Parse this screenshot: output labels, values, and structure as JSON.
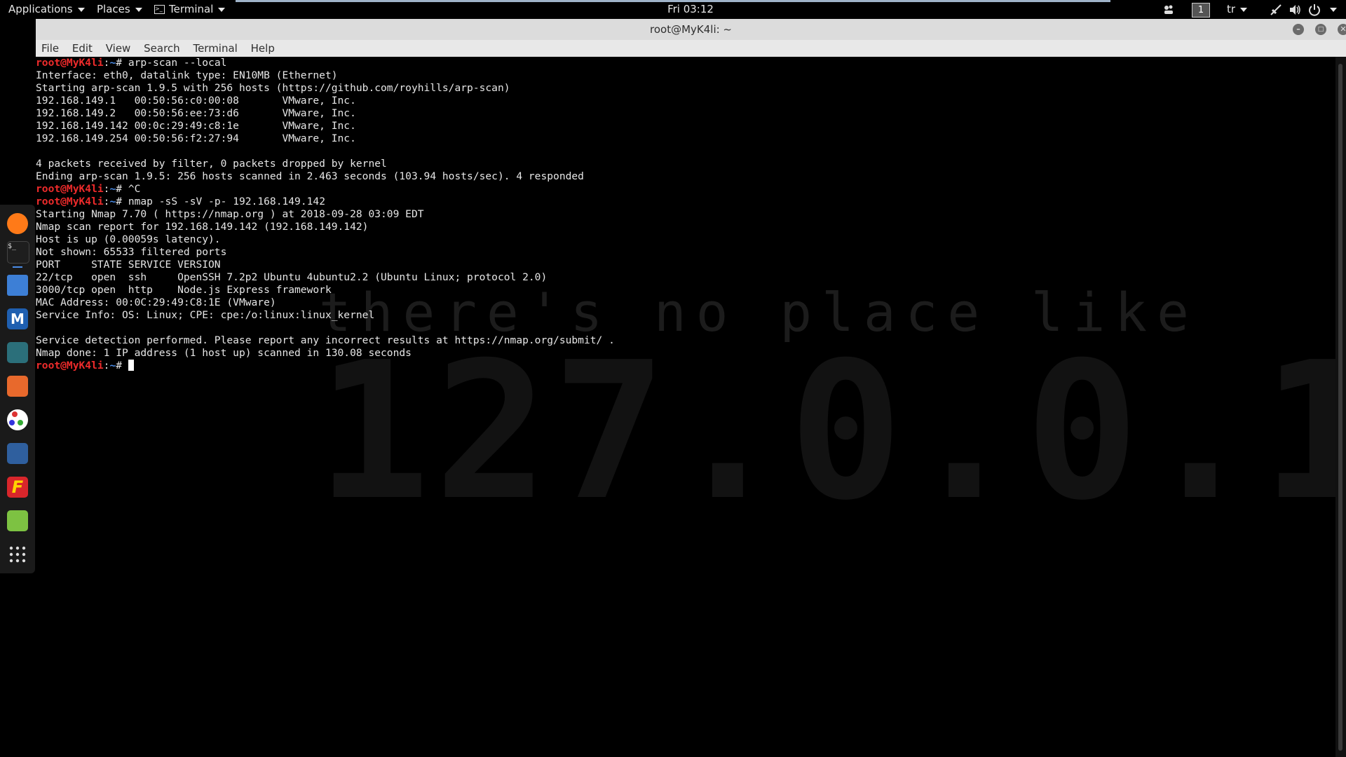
{
  "topbar": {
    "applications": "Applications",
    "places": "Places",
    "terminal": "Terminal",
    "clock": "Fri 03:12",
    "workspace": "1",
    "keyboard_layout": "tr",
    "icons": [
      "workspaces-icon",
      "network-icon",
      "volume-icon",
      "power-icon"
    ]
  },
  "dock": {
    "apps": [
      {
        "name": "firefox-icon",
        "color": "#ff7a18"
      },
      {
        "name": "terminal-icon",
        "color": "#1e1e1e"
      },
      {
        "name": "files-icon",
        "color": "#3d7fd6"
      },
      {
        "name": "metasploit-icon",
        "color": "#1f5fb0"
      },
      {
        "name": "armitage-icon",
        "color": "#2b6f7a"
      },
      {
        "name": "burpsuite-icon",
        "color": "#e8692c"
      },
      {
        "name": "maltego-icon",
        "color": "#2a2a2a"
      },
      {
        "name": "beef-icon",
        "color": "#2f5f9e"
      },
      {
        "name": "faraday-icon",
        "color": "#d8262b"
      },
      {
        "name": "leafpad-icon",
        "color": "#7dc242"
      },
      {
        "name": "show-apps-icon",
        "color": "#1a1a1a"
      }
    ]
  },
  "window": {
    "title": "root@MyK4li: ~",
    "menu": [
      "File",
      "Edit",
      "View",
      "Search",
      "Terminal",
      "Help"
    ]
  },
  "wallpaper": {
    "line1": "there's no place like",
    "line2": "127.0.0.1"
  },
  "prompt": {
    "user": "root@MyK4li",
    "sep": ":",
    "dir": "~",
    "symbol": "# "
  },
  "terminal": {
    "lines": [
      {
        "prompt": true,
        "text": "arp-scan --local"
      },
      {
        "text": "Interface: eth0, datalink type: EN10MB (Ethernet)"
      },
      {
        "text": "Starting arp-scan 1.9.5 with 256 hosts (https://github.com/royhills/arp-scan)"
      },
      {
        "text": "192.168.149.1   00:50:56:c0:00:08       VMware, Inc."
      },
      {
        "text": "192.168.149.2   00:50:56:ee:73:d6       VMware, Inc."
      },
      {
        "text": "192.168.149.142 00:0c:29:49:c8:1e       VMware, Inc."
      },
      {
        "text": "192.168.149.254 00:50:56:f2:27:94       VMware, Inc."
      },
      {
        "text": ""
      },
      {
        "text": "4 packets received by filter, 0 packets dropped by kernel"
      },
      {
        "text": "Ending arp-scan 1.9.5: 256 hosts scanned in 2.463 seconds (103.94 hosts/sec). 4 responded"
      },
      {
        "prompt": true,
        "text": "^C"
      },
      {
        "prompt": true,
        "text": "nmap -sS -sV -p- 192.168.149.142"
      },
      {
        "text": "Starting Nmap 7.70 ( https://nmap.org ) at 2018-09-28 03:09 EDT"
      },
      {
        "text": "Nmap scan report for 192.168.149.142 (192.168.149.142)"
      },
      {
        "text": "Host is up (0.00059s latency)."
      },
      {
        "text": "Not shown: 65533 filtered ports"
      },
      {
        "text": "PORT     STATE SERVICE VERSION"
      },
      {
        "text": "22/tcp   open  ssh     OpenSSH 7.2p2 Ubuntu 4ubuntu2.2 (Ubuntu Linux; protocol 2.0)"
      },
      {
        "text": "3000/tcp open  http    Node.js Express framework"
      },
      {
        "text": "MAC Address: 00:0C:29:49:C8:1E (VMware)"
      },
      {
        "text": "Service Info: OS: Linux; CPE: cpe:/o:linux:linux_kernel"
      },
      {
        "text": ""
      },
      {
        "text": "Service detection performed. Please report any incorrect results at https://nmap.org/submit/ ."
      },
      {
        "text": "Nmap done: 1 IP address (1 host up) scanned in 130.08 seconds"
      },
      {
        "prompt": true,
        "text": "",
        "cursor": true
      }
    ]
  }
}
